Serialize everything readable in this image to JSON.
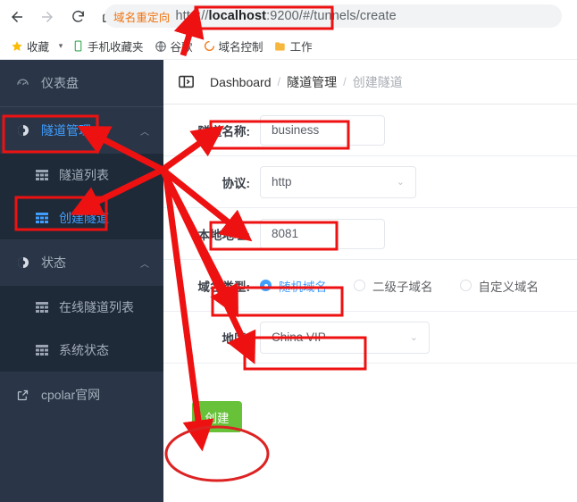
{
  "browser": {
    "nav": {
      "back": "back-arrow",
      "forward": "forward-arrow",
      "reload": "reload-icon",
      "home": "home-icon"
    },
    "urlbar": {
      "tag": "域名重定向",
      "scheme": "http://",
      "host": "localhost",
      "rest": ":9200/#/tunnels/create",
      "full_url": "http://localhost:9200/#/tunnels/create"
    },
    "bookmarks": [
      {
        "label": "收藏",
        "icon": "star-icon",
        "has_caret": true
      },
      {
        "label": "手机收藏夹",
        "icon": "phone-icon",
        "has_caret": false
      },
      {
        "label": "谷歌",
        "icon": "globe-icon",
        "has_caret": false
      },
      {
        "label": "域名控制",
        "icon": "domain-icon",
        "has_caret": false
      },
      {
        "label": "工作",
        "icon": "folder-icon",
        "has_caret": false
      }
    ]
  },
  "sidebar": {
    "items": [
      {
        "label": "仪表盘",
        "icon": "dashboard-icon",
        "type": "group",
        "selected": false,
        "caret": ""
      },
      {
        "label": "隧道管理",
        "icon": "tunnel-icon",
        "type": "group",
        "selected": true,
        "caret": "︿"
      },
      {
        "label": "隧道列表",
        "icon": "grid-icon",
        "type": "sub",
        "selected": false
      },
      {
        "label": "创建隧道",
        "icon": "grid-icon",
        "type": "sub",
        "selected": true
      },
      {
        "label": "状态",
        "icon": "status-icon",
        "type": "group",
        "selected": false,
        "caret": "︿"
      },
      {
        "label": "在线隧道列表",
        "icon": "grid-icon",
        "type": "sub",
        "selected": false
      },
      {
        "label": "系统状态",
        "icon": "grid-icon",
        "type": "sub",
        "selected": false
      },
      {
        "label": "cpolar官网",
        "icon": "external-link-icon",
        "type": "group",
        "selected": false,
        "caret": ""
      }
    ]
  },
  "content": {
    "collapse_icon": "menu-collapse-icon",
    "breadcrumb": [
      {
        "label": "Dashboard",
        "current": false
      },
      {
        "label": "隧道管理",
        "current": false
      },
      {
        "label": "创建隧道",
        "current": true
      }
    ],
    "breadcrumb_separator": "/",
    "form": {
      "tunnel_name": {
        "label": "隧道名称:",
        "value": "business",
        "placeholder": ""
      },
      "protocol": {
        "label": "协议:",
        "value": "http",
        "chevron": "chevron-down-icon"
      },
      "local_address": {
        "label": "本地地址:",
        "value": "8081",
        "placeholder": ""
      },
      "domain_type": {
        "label": "域名类型:",
        "options": [
          {
            "label": "随机域名",
            "selected": true
          },
          {
            "label": "二级子域名",
            "selected": false
          },
          {
            "label": "自定义域名",
            "selected": false
          }
        ]
      },
      "region": {
        "label": "地区:",
        "value": "China VIP",
        "chevron": "chevron-down-icon"
      },
      "submit": {
        "label": "创建"
      }
    }
  },
  "colors": {
    "sidebar_bg": "#2a3647",
    "sidebar_sub_bg": "#1f2a38",
    "accent_blue": "#409eff",
    "submit_green": "#67c23a",
    "annotation_red": "#ee1111",
    "url_tag_orange": "#f2720c"
  }
}
